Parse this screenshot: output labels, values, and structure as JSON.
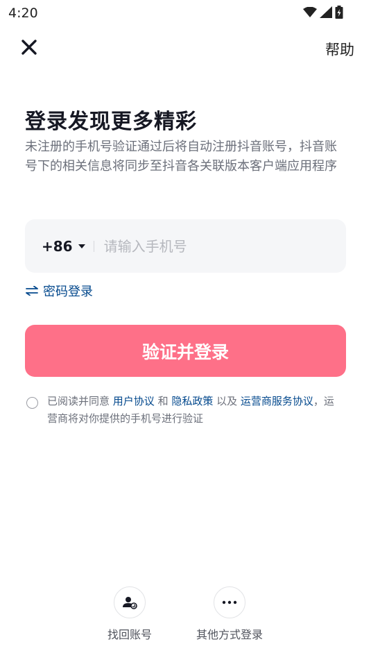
{
  "status_bar": {
    "time": "4:20",
    "icons": [
      "wifi-icon",
      "cellular-signal-icon",
      "battery-icon"
    ]
  },
  "top_bar": {
    "close_icon": "close-icon",
    "help_label": "帮助"
  },
  "header": {
    "title": "登录发现更多精彩",
    "subtitle": "未注册的手机号验证通过后将自动注册抖音账号，抖音账号下的相关信息将同步至抖音各关联版本客户端应用程序"
  },
  "phone_form": {
    "country_code": "+86",
    "phone_value": "",
    "phone_placeholder": "请输入手机号"
  },
  "password_login": {
    "icon": "swap-arrows-icon",
    "label": "密码登录"
  },
  "login_button": {
    "label": "验证并登录"
  },
  "agreement": {
    "checked": false,
    "text_prefix": "已阅读并同意 ",
    "user_agreement": "用户协议",
    "and": " 和 ",
    "privacy_policy": "隐私政策",
    "and_also": " 以及 ",
    "carrier_agreement": "运营商服务协议",
    "text_suffix": "，运营商将对你提供的手机号进行验证"
  },
  "bottom_actions": [
    {
      "icon": "recover-account-icon",
      "label": "找回账号"
    },
    {
      "icon": "more-options-icon",
      "label": "其他方式登录"
    }
  ],
  "colors": {
    "accent": "#fe7088",
    "link": "#04498d",
    "input_bg": "#f5f6f8",
    "title": "#161823",
    "muted_text": "#6b6f7a"
  }
}
